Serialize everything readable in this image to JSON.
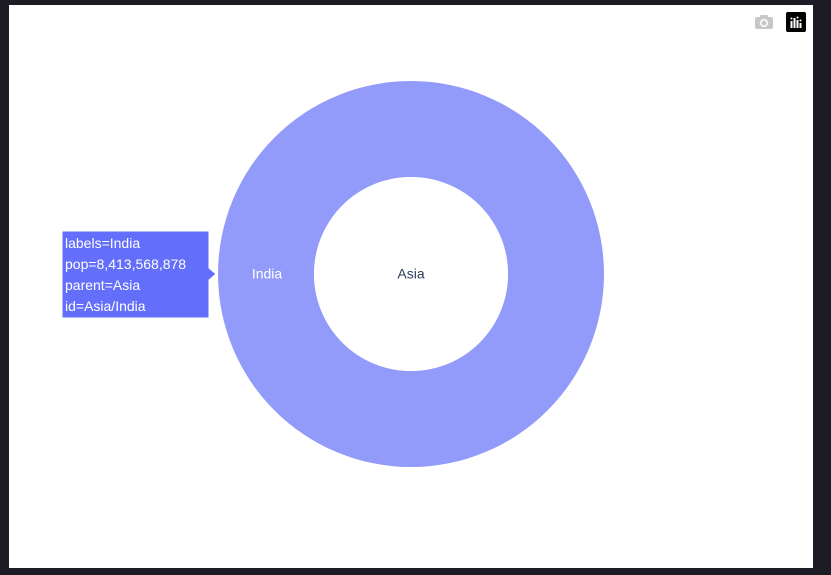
{
  "modebar": {
    "camera_icon": "camera-icon",
    "logo_icon": "plotly-logo-icon"
  },
  "colors": {
    "outer_segment": "#939bfa",
    "hover_bg": "#636efa",
    "center_text": "#2a3f5f",
    "segment_text": "#ffffff"
  },
  "chart_data": {
    "type": "sunburst",
    "nodes": [
      {
        "id": "Asia",
        "label": "Asia",
        "parent": "",
        "pop": 8413568878
      },
      {
        "id": "Asia/India",
        "label": "India",
        "parent": "Asia",
        "pop": 8413568878
      }
    ]
  },
  "tooltip": {
    "line1": "labels=India",
    "line2": "pop=8,413,568,878",
    "line3": "parent=Asia",
    "line4": "id=Asia/India"
  }
}
